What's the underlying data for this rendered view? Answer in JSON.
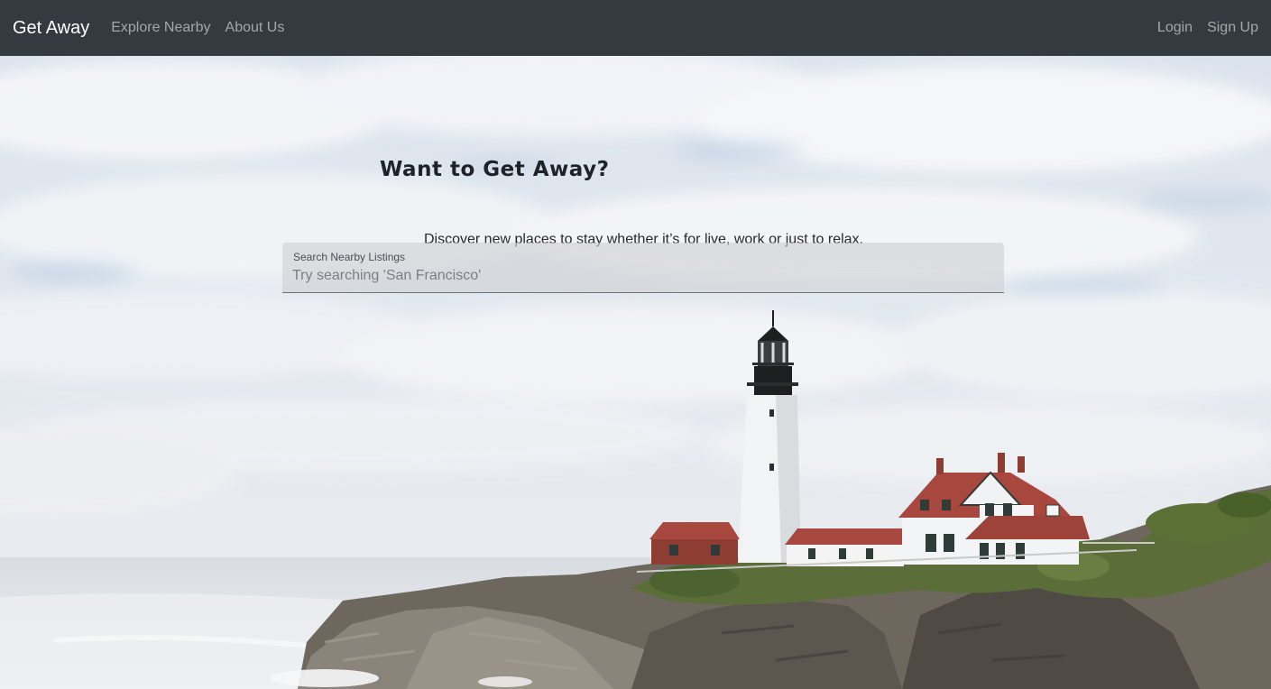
{
  "nav": {
    "brand": "Get Away",
    "links": [
      "Explore Nearby",
      "About Us"
    ],
    "auth": [
      "Login",
      "Sign Up"
    ]
  },
  "hero": {
    "headline": "Want to Get Away?",
    "subtitle": "Discover new places to stay whether it’s for live, work or just to relax.",
    "search": {
      "label": "Search Nearby Listings",
      "placeholder": "Try searching 'San Francisco'",
      "value": ""
    }
  },
  "colors": {
    "navbar": "#343a40",
    "sky": "#dfe6ee",
    "sea": "#e6eaee",
    "roof": "#a8473d"
  }
}
